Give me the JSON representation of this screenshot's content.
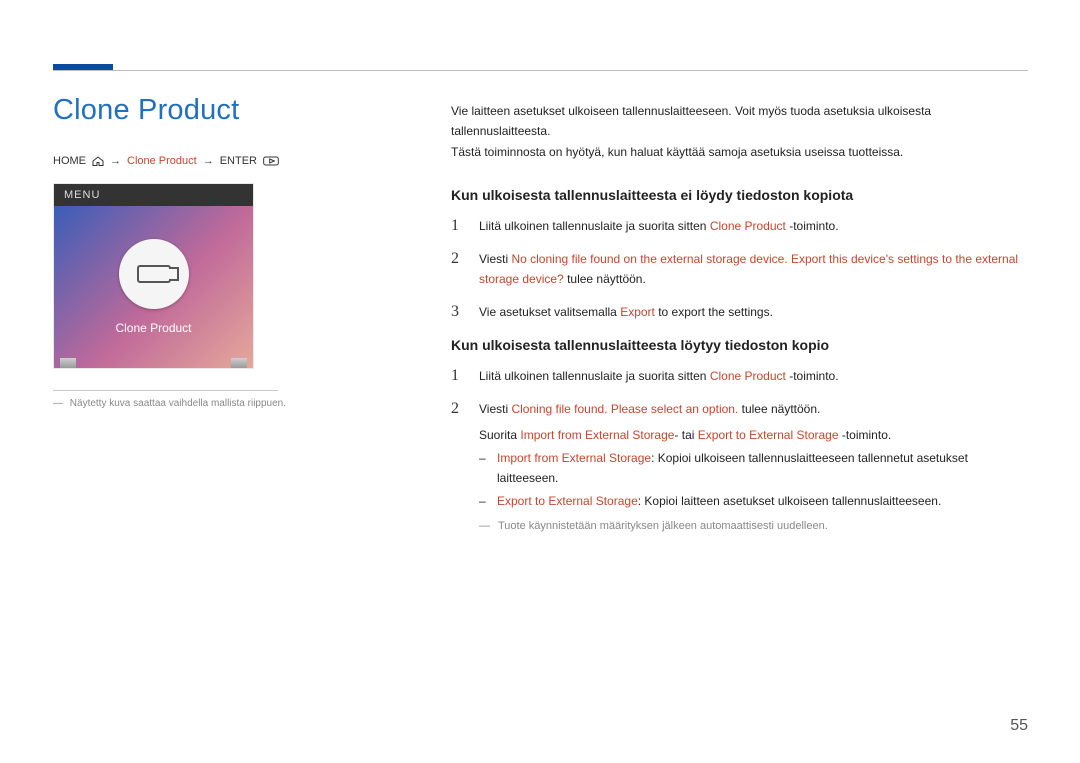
{
  "page": {
    "title": "Clone Product",
    "number": "55"
  },
  "breadcrumb": {
    "home": "HOME",
    "arrow1": "→",
    "clone": "Clone Product",
    "arrow2": "→",
    "enter": "ENTER"
  },
  "thumb": {
    "menu": "MENU",
    "label": "Clone Product",
    "note_prefix": "―",
    "note": "Näytetty kuva saattaa vaihdella mallista riippuen."
  },
  "intro": {
    "l1": "Vie laitteen asetukset ulkoiseen tallennuslaitteeseen. Voit myös tuoda asetuksia ulkoisesta tallennuslaitteesta.",
    "l2": "Tästä toiminnosta on hyötyä, kun haluat käyttää samoja asetuksia useissa tuotteissa."
  },
  "sectionA": {
    "heading": "Kun ulkoisesta tallennuslaitteesta ei löydy tiedoston kopiota",
    "s1": {
      "num": "1",
      "a": "Liitä ulkoinen tallennuslaite ja suorita sitten ",
      "b": "Clone Product",
      "c": " -toiminto."
    },
    "s2": {
      "num": "2",
      "a": "Viesti ",
      "b": "No cloning file found on the external storage device. Export this device's settings to the external storage device?",
      "c": " tulee näyttöön."
    },
    "s3": {
      "num": "3",
      "a": "Vie asetukset valitsemalla ",
      "b": "Export",
      "c": " to export the settings."
    }
  },
  "sectionB": {
    "heading": "Kun ulkoisesta tallennuslaitteesta löytyy tiedoston kopio",
    "s1": {
      "num": "1",
      "a": "Liitä ulkoinen tallennuslaite ja suorita sitten ",
      "b": "Clone Product",
      "c": " -toiminto."
    },
    "s2": {
      "num": "2",
      "a": "Viesti ",
      "b": "Cloning file found. Please select an option.",
      "c": " tulee näyttöön.",
      "line2": {
        "a": "Suorita ",
        "b": "Import from External Storage",
        "c": "- tai ",
        "d": "Export to External Storage",
        "e": " -toiminto."
      },
      "dash1": {
        "bullet": "–",
        "a": "Import from External Storage",
        "b": ": Kopioi ulkoiseen tallennuslaitteeseen tallennetut asetukset laitteeseen."
      },
      "dash2": {
        "bullet": "–",
        "a": "Export to External Storage",
        "b": ": Kopioi laitteen asetukset ulkoiseen tallennuslaitteeseen."
      },
      "foot": {
        "dash": "―",
        "text": "Tuote käynnistetään määrityksen jälkeen automaattisesti uudelleen."
      }
    }
  }
}
